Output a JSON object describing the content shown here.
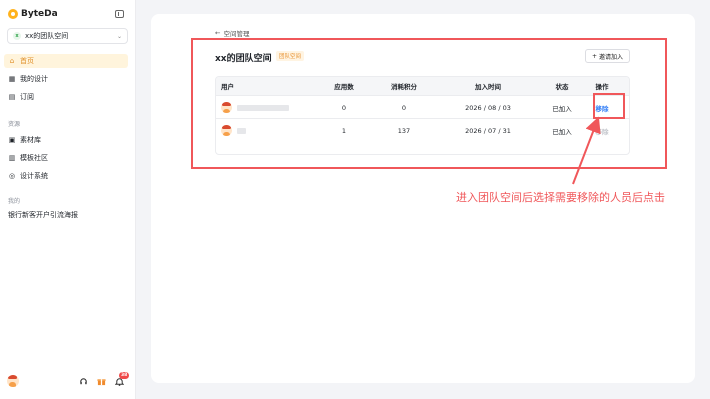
{
  "app": {
    "name": "ByteDa"
  },
  "sidebar": {
    "team_select": {
      "badge": "x",
      "name": "xx的团队空间"
    },
    "items": [
      {
        "label": "首页",
        "icon": "home-icon",
        "active": true
      },
      {
        "label": "我的设计",
        "icon": "grid-icon",
        "active": false
      },
      {
        "label": "订阅",
        "icon": "subscription-icon",
        "active": false
      }
    ],
    "resources_label": "资源",
    "resource_items": [
      {
        "label": "素材库",
        "icon": "image-icon"
      },
      {
        "label": "模板社区",
        "icon": "template-icon"
      },
      {
        "label": "设计系统",
        "icon": "palette-icon"
      }
    ],
    "mine_label": "我的",
    "mine_items": [
      {
        "label": "银行新客开户引流海报"
      }
    ],
    "notification_count": "38"
  },
  "main": {
    "breadcrumb": "空间管理",
    "title": "xx的团队空间",
    "tag": "团队空间",
    "invite_button": "邀请加入",
    "table": {
      "headers": [
        "用户",
        "应用数",
        "消耗积分",
        "加入时间",
        "状态",
        "操作"
      ],
      "rows": [
        {
          "apps": "0",
          "points": "0",
          "joined": "2026 / 08 / 03",
          "status": "已加入",
          "action": "移除",
          "action_enabled": true
        },
        {
          "apps": "1",
          "points": "137",
          "joined": "2026 / 07 / 31",
          "status": "已加入",
          "action": "移除",
          "action_enabled": false
        }
      ]
    }
  },
  "annotation": "进入团队空间后选择需要移除的人员后点击",
  "colors": {
    "accent": "#e0902a",
    "highlight": "#f0575a",
    "link": "#2f7cf6"
  }
}
